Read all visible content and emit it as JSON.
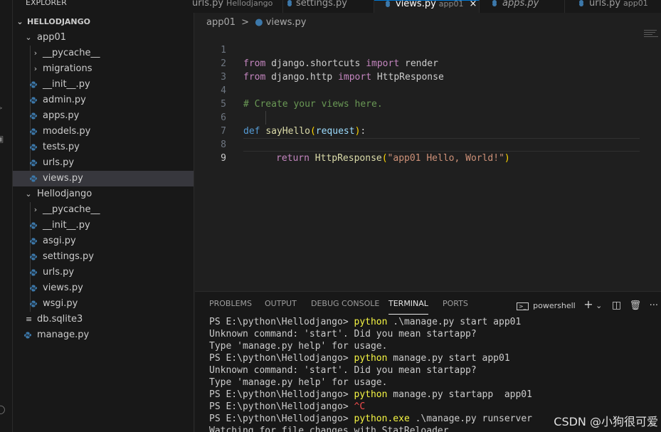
{
  "sidebar": {
    "title": "EXPLORER",
    "more": "···",
    "root": "HELLODJANGO",
    "items": [
      {
        "label": "app01"
      },
      {
        "label": "__pycache__"
      },
      {
        "label": "migrations"
      },
      {
        "label": "__init__.py"
      },
      {
        "label": "admin.py"
      },
      {
        "label": "apps.py"
      },
      {
        "label": "models.py"
      },
      {
        "label": "tests.py"
      },
      {
        "label": "urls.py"
      },
      {
        "label": "views.py"
      },
      {
        "label": "Hellodjango"
      },
      {
        "label": "__pycache__"
      },
      {
        "label": "__init__.py"
      },
      {
        "label": "asgi.py"
      },
      {
        "label": "settings.py"
      },
      {
        "label": "urls.py"
      },
      {
        "label": "views.py"
      },
      {
        "label": "wsgi.py"
      },
      {
        "label": "db.sqlite3"
      },
      {
        "label": "manage.py"
      }
    ]
  },
  "tabs": [
    {
      "name": "urls.py",
      "sub": "Hellodjango"
    },
    {
      "name": "settings.py",
      "sub": ""
    },
    {
      "name": "views.py",
      "sub": "app01",
      "close": "×"
    },
    {
      "name": "apps.py",
      "sub": ""
    },
    {
      "name": "urls.py",
      "sub": "app01"
    }
  ],
  "breadcrumb": {
    "folder": "app01",
    "sep": ">",
    "file": "views.py"
  },
  "editor": {
    "line_numbers": [
      "1",
      "2",
      "3",
      "4",
      "5",
      "6",
      "7",
      "8",
      "9"
    ],
    "l1": {
      "kw1": "from",
      "mod": " django.shortcuts ",
      "kw2": "import",
      "name": " render"
    },
    "l2": {
      "kw1": "from",
      "mod": " django.http ",
      "kw2": "import",
      "name": " HttpResponse"
    },
    "l4": {
      "comment": "# Create your views here."
    },
    "l6": {
      "def": "def",
      "fn": "sayHello",
      "open": "(",
      "param": "request",
      "close": ")",
      "colon": ":"
    },
    "l7": {
      "ret": "return",
      "fn": "HttpResponse",
      "open": "(",
      "str": "\"app01 Hello, World!\"",
      "close": ")"
    }
  },
  "panel": {
    "tabs": [
      "PROBLEMS",
      "OUTPUT",
      "DEBUG CONSOLE",
      "TERMINAL",
      "PORTS"
    ],
    "shell": "powershell",
    "terminal": [
      {
        "prompt": "PS E:\\python\\Hellodjango> ",
        "cmd": "python",
        "rest": " .\\manage.py start app01"
      },
      {
        "text": "Unknown command: 'start'. Did you mean startapp?"
      },
      {
        "text": "Type 'manage.py help' for usage."
      },
      {
        "prompt": "PS E:\\python\\Hellodjango> ",
        "cmd": "python",
        "rest": " manage.py start app01"
      },
      {
        "text": "Unknown command: 'start'. Did you mean startapp?"
      },
      {
        "text": "Type 'manage.py help' for usage."
      },
      {
        "prompt": "PS E:\\python\\Hellodjango> ",
        "cmd": "python",
        "rest": " manage.py startapp  app01"
      },
      {
        "prompt": "PS E:\\python\\Hellodjango> ",
        "ctrl": "^C"
      },
      {
        "prompt": "PS E:\\python\\Hellodjango> ",
        "cmd": "python.exe",
        "rest": " .\\manage.py runserver"
      },
      {
        "text": "Watching for file changes with StatReloader"
      }
    ]
  },
  "watermark": "CSDN @小狗很可爱",
  "colors": {
    "accent": "#0078d4",
    "python_icon": "#3c78aa",
    "keyword": "#c586c0",
    "string": "#ce9178",
    "comment": "#6a9955"
  }
}
